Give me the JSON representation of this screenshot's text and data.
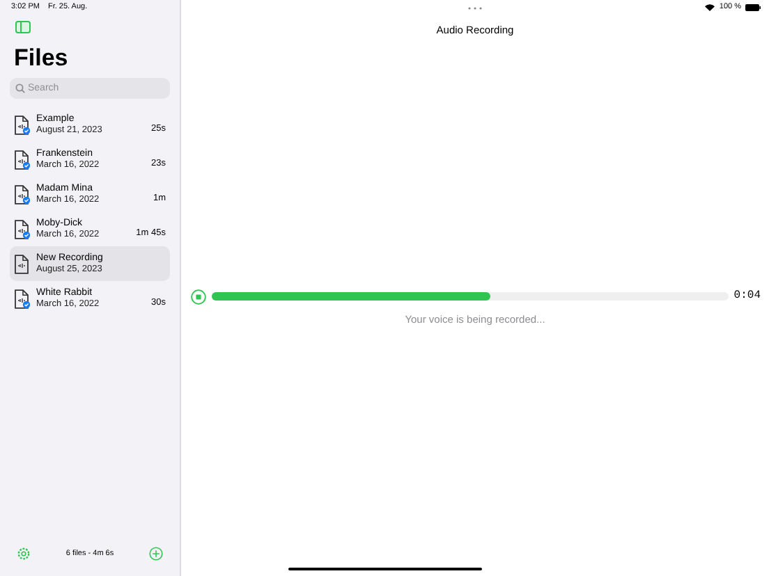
{
  "status_bar": {
    "time": "3:02 PM",
    "date": "Fr. 25. Aug.",
    "battery": "100 %"
  },
  "sidebar": {
    "title": "Files",
    "search": {
      "placeholder": "Search"
    },
    "files": [
      {
        "name": "Example",
        "date": "August 21, 2023",
        "duration": "25s",
        "synced": true,
        "selected": false
      },
      {
        "name": "Frankenstein",
        "date": "March 16, 2022",
        "duration": "23s",
        "synced": true,
        "selected": false
      },
      {
        "name": "Madam Mina",
        "date": "March 16, 2022",
        "duration": "1m",
        "synced": true,
        "selected": false
      },
      {
        "name": "Moby-Dick",
        "date": "March 16, 2022",
        "duration": "1m 45s",
        "synced": true,
        "selected": false
      },
      {
        "name": "New Recording",
        "date": "August 25, 2023",
        "synced": false,
        "selected": true
      },
      {
        "name": "White Rabbit",
        "date": "March 16, 2022",
        "duration": "30s",
        "synced": true,
        "selected": false
      }
    ],
    "footer": "6 files - 4m 6s"
  },
  "main": {
    "title": "Audio Recording",
    "recording": {
      "level": 0.54,
      "time": "0:04",
      "caption": "Your voice is being recorded..."
    }
  }
}
